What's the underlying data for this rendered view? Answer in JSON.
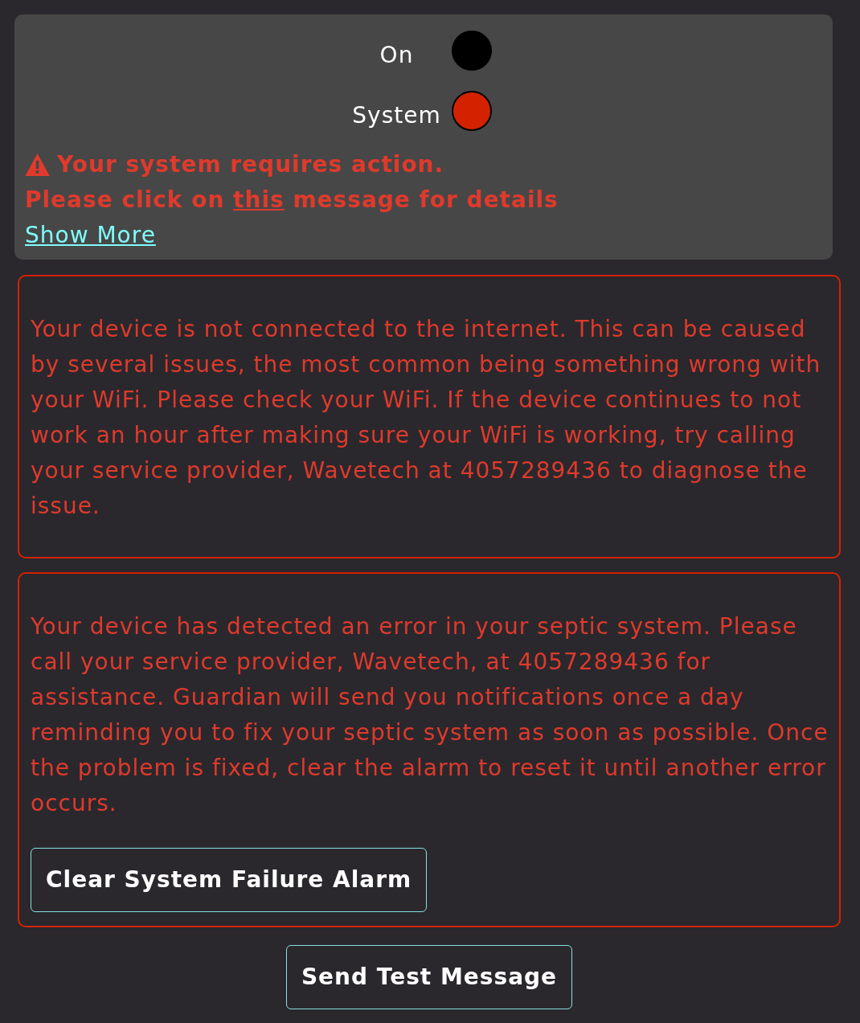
{
  "status_panel": {
    "indicators": [
      {
        "label": "On",
        "color": "#000000"
      },
      {
        "label": "System",
        "color": "#d42200"
      }
    ],
    "warning": {
      "title": "Your system requires action.",
      "message": {
        "before": "Please click on",
        "link": "this",
        "after": "message for details"
      }
    },
    "show_more": "Show More"
  },
  "alerts": [
    {
      "text": "Your device is not connected to the internet. This can be caused by several issues, the most common being something wrong with your WiFi. Please check your WiFi. If the device continues to not work an hour after making sure your WiFi is working, try calling your service provider, Wavetech at 4057289436 to diagnose the issue."
    },
    {
      "text": "Your device has detected an error in your septic system. Please call your service provider, Wavetech, at 4057289436 for assistance. Guardian will send you notifications once a day reminding you to fix your septic system as soon as possible. Once the problem is fixed, clear the alarm to reset it until another error occurs.",
      "button": "Clear System Failure Alarm"
    }
  ],
  "footer_button": "Send Test Message"
}
